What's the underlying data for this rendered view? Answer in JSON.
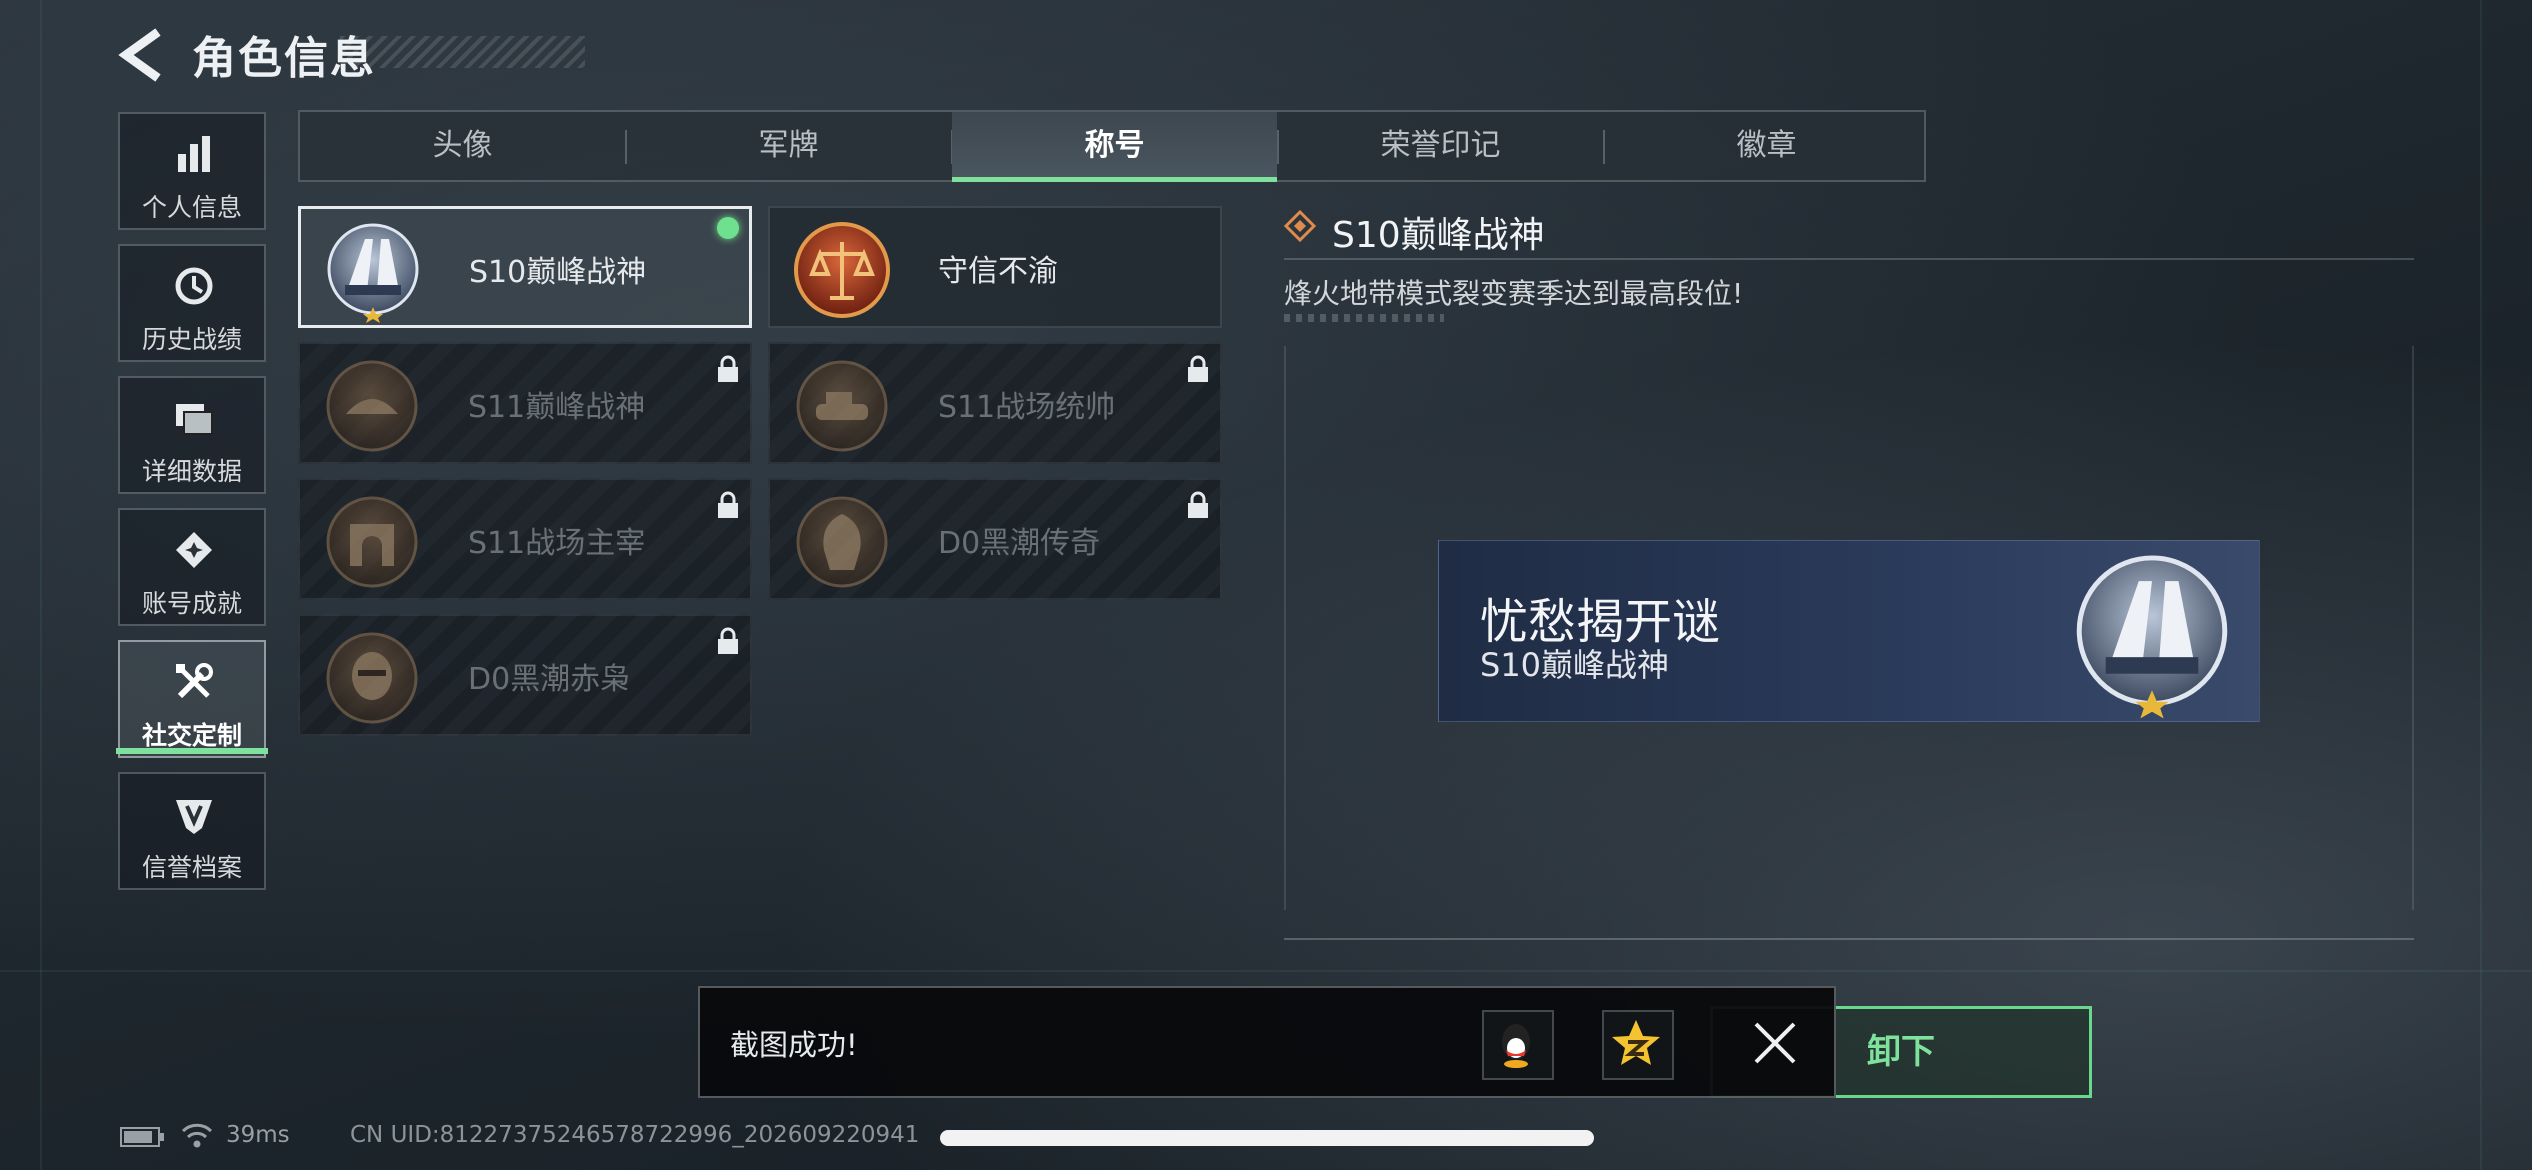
{
  "header": {
    "title": "角色信息"
  },
  "nav": {
    "items": [
      {
        "label": "个人信息",
        "icon": "bar-chart-icon"
      },
      {
        "label": "历史战绩",
        "icon": "history-clock-icon"
      },
      {
        "label": "详细数据",
        "icon": "folder-icon"
      },
      {
        "label": "账号成就",
        "icon": "achievement-icon"
      },
      {
        "label": "社交定制",
        "icon": "tools-icon",
        "active": true
      },
      {
        "label": "信誉档案",
        "icon": "credit-shield-icon"
      }
    ]
  },
  "tabs": [
    {
      "label": "头像"
    },
    {
      "label": "军牌"
    },
    {
      "label": "称号",
      "active": true
    },
    {
      "label": "荣誉印记"
    },
    {
      "label": "徽章"
    }
  ],
  "titles": [
    {
      "name": "S10巅峰战神",
      "selected": true,
      "equipped": true,
      "locked": false
    },
    {
      "name": "守信不渝",
      "locked": false
    },
    {
      "name": "S11巅峰战神",
      "locked": true
    },
    {
      "name": "S11战场统帅",
      "locked": true
    },
    {
      "name": "S11战场主宰",
      "locked": true
    },
    {
      "name": "D0黑潮传奇",
      "locked": true
    },
    {
      "name": "D0黑潮赤枭",
      "locked": true
    }
  ],
  "detail": {
    "name": "S10巅峰战神",
    "description": "烽火地带模式裂变赛季达到最高段位!",
    "preview_motto": "忧愁揭开谜",
    "preview_title": "S10巅峰战神",
    "unequip_label": "卸下"
  },
  "toast": {
    "message": "截图成功!",
    "share_icons": [
      "qq-icon",
      "qzone-icon"
    ],
    "close_icon": "close-icon"
  },
  "status": {
    "ping": "39ms",
    "uid": "CN UID:812273752465787229​96_202609220941"
  },
  "colors": {
    "accent": "#7ee29d",
    "equipped": "#6fe08e",
    "selected_border": "#e8ecee"
  }
}
